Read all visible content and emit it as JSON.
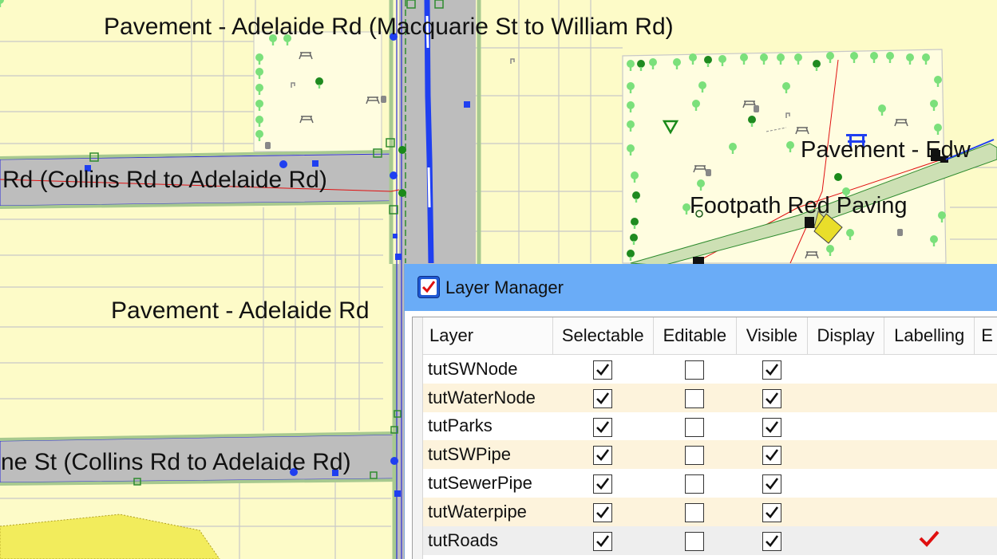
{
  "map": {
    "labels": {
      "adelaide_top": "Pavement - Adelaide Rd (Macquarie St to William Rd)",
      "collins_adelaide_1": "Rd (Collins Rd to Adelaide Rd)",
      "adelaide_mid": "Pavement - Adelaide Rd",
      "collins_adelaide_2": "ne St (Collins Rd to Adelaide Rd)",
      "edward": "Pavement - Edw",
      "footpath": "Footpath Red Paving"
    },
    "colors": {
      "background": "#fdfbc8",
      "road": "#bdbdbd",
      "road_edge": "#a7c98f",
      "parcel_line": "#c8c8c8",
      "sw_pipe": "#1f3ff0",
      "water_pipe": "#e01010",
      "tree": "#7be07b",
      "park_fill": "#fffde0"
    }
  },
  "layer_manager": {
    "title": "Layer Manager",
    "icon": "layer-manager-check-icon",
    "columns": [
      "Layer",
      "Selectable",
      "Editable",
      "Visible",
      "Display",
      "Labelling",
      "E"
    ],
    "rows": [
      {
        "layer": "tutSWNode",
        "selectable": true,
        "editable": false,
        "visible": true,
        "labelling": false
      },
      {
        "layer": "tutWaterNode",
        "selectable": true,
        "editable": false,
        "visible": true,
        "labelling": false
      },
      {
        "layer": "tutParks",
        "selectable": true,
        "editable": false,
        "visible": true,
        "labelling": false
      },
      {
        "layer": "tutSWPipe",
        "selectable": true,
        "editable": false,
        "visible": true,
        "labelling": false
      },
      {
        "layer": "tutSewerPipe",
        "selectable": true,
        "editable": false,
        "visible": true,
        "labelling": false
      },
      {
        "layer": "tutWaterpipe",
        "selectable": true,
        "editable": false,
        "visible": true,
        "labelling": false
      },
      {
        "layer": "tutRoads",
        "selectable": true,
        "editable": false,
        "visible": true,
        "labelling": true
      }
    ],
    "colors": {
      "title_bar": "#6aacf7",
      "row_alt": "#fdf3dc",
      "row_selected": "#eeeeee",
      "labelling_check": "#e01010"
    }
  }
}
